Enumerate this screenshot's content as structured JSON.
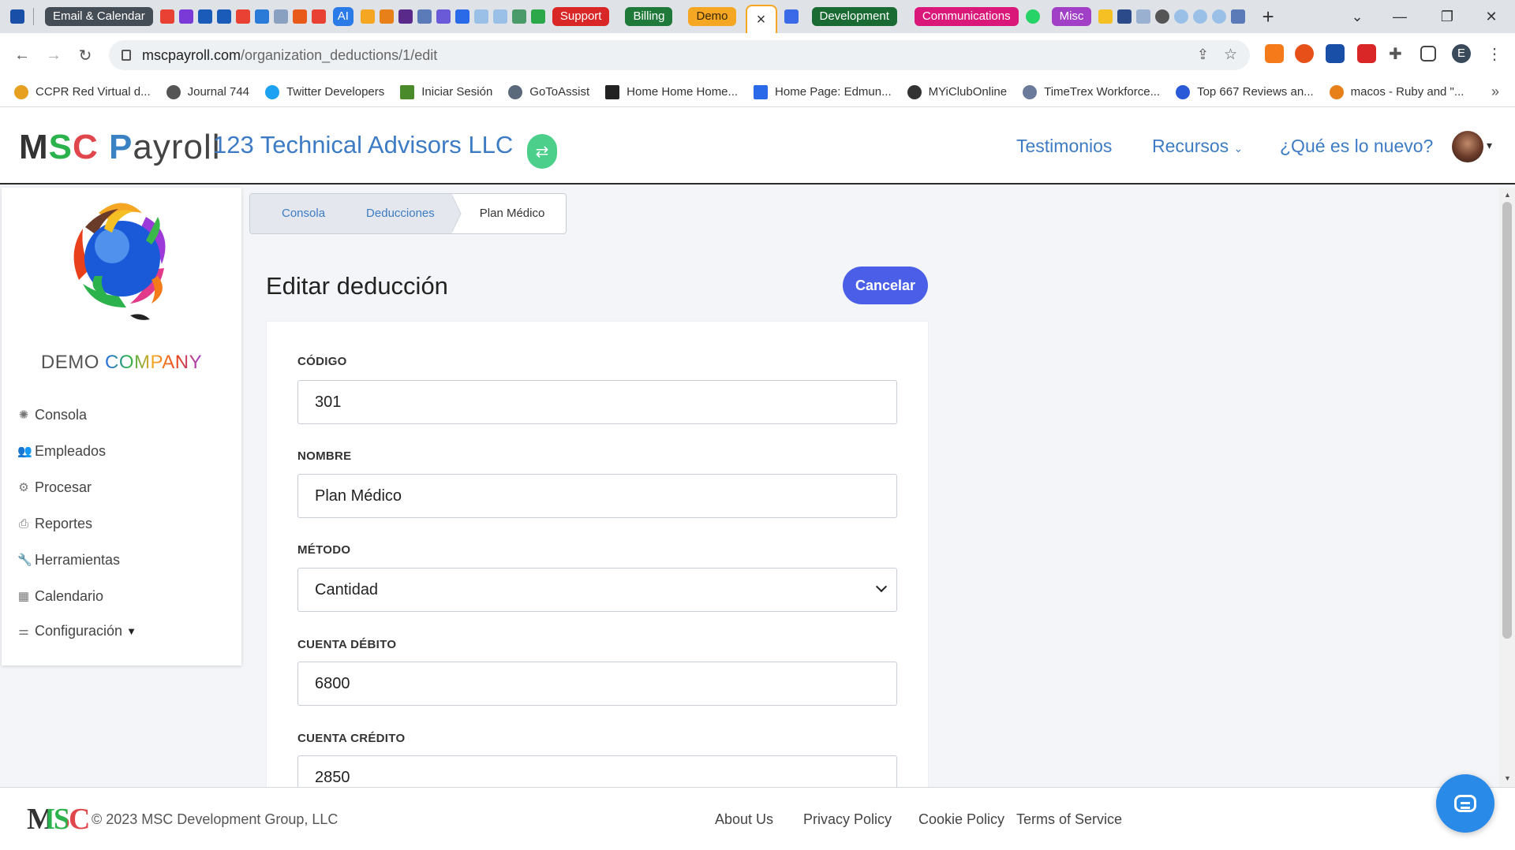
{
  "browser": {
    "tab_groups": [
      {
        "label": "Email & Calendar",
        "color": "gray"
      },
      {
        "label": "AI",
        "color": "blue"
      },
      {
        "label": "Support",
        "color": "red"
      },
      {
        "label": "Billing",
        "color": "green"
      },
      {
        "label": "Demo",
        "color": "orange"
      },
      {
        "label": "Development",
        "color": "dgreen"
      },
      {
        "label": "Communications",
        "color": "pink"
      },
      {
        "label": "Misc",
        "color": "purple"
      }
    ],
    "active_tab_close": "×",
    "new_tab": "+",
    "url_host": "mscpayroll.com",
    "url_path": "/organization_deductions/1/edit",
    "profile_initial": "E",
    "bookmarks": [
      {
        "label": "CCPR Red Virtual d...",
        "icon": "sun-icon",
        "color": "#e8a020"
      },
      {
        "label": "Journal 744",
        "icon": "globe-icon",
        "color": "#555555"
      },
      {
        "label": "Twitter Developers",
        "icon": "twitter-icon",
        "color": "#1da1f2"
      },
      {
        "label": "Iniciar Sesión",
        "icon": "l-icon",
        "color": "#4a8a2a"
      },
      {
        "label": "GoToAssist",
        "icon": "gotoassist-icon",
        "color": "#5a6a7a"
      },
      {
        "label": "Home Home Home...",
        "icon": "x-icon",
        "color": "#222222"
      },
      {
        "label": "Home Page: Edmun...",
        "icon": "f-icon",
        "color": "#2a6ae8"
      },
      {
        "label": "MYiClubOnline",
        "icon": "club-icon",
        "color": "#333333"
      },
      {
        "label": "TimeTrex Workforce...",
        "icon": "timetrex-icon",
        "color": "#6a7a9a"
      },
      {
        "label": "Top 667 Reviews an...",
        "icon": "star-icon",
        "color": "#2a5ad8"
      },
      {
        "label": "macos - Ruby and \"...",
        "icon": "stack-icon",
        "color": "#e8801a"
      }
    ],
    "more_bookmarks": "»"
  },
  "header": {
    "logo_m": "M",
    "logo_s": "S",
    "logo_c": "C",
    "logo_p": "P",
    "logo_rest": "ayroll",
    "org_name": "123 Technical Advisors LLC",
    "nav": {
      "testimonials": "Testimonios",
      "resources": "Recursos",
      "whats_new": "¿Qué es lo nuevo?"
    }
  },
  "sidebar": {
    "company_demo": "DEMO ",
    "company_word": "COMPANY",
    "items": [
      {
        "label": "Consola",
        "icon": "dashboard-icon"
      },
      {
        "label": "Empleados",
        "icon": "users-icon"
      },
      {
        "label": "Procesar",
        "icon": "cogs-icon"
      },
      {
        "label": "Reportes",
        "icon": "printer-icon"
      },
      {
        "label": "Herramientas",
        "icon": "wrench-icon"
      },
      {
        "label": "Calendario",
        "icon": "calendar-icon"
      },
      {
        "label": "Configuración",
        "icon": "sliders-icon"
      }
    ]
  },
  "breadcrumb": [
    "Consola",
    "Deducciones",
    "Plan Médico"
  ],
  "form": {
    "title": "Editar deducción",
    "cancel_label": "Cancelar",
    "fields": [
      {
        "label": "CÓDIGO",
        "value": "301"
      },
      {
        "label": "NOMBRE",
        "value": "Plan Médico"
      },
      {
        "label": "MÉTODO",
        "value": "Cantidad"
      },
      {
        "label": "CUENTA DÉBITO",
        "value": "6800"
      },
      {
        "label": "CUENTA CRÉDITO",
        "value": "2850"
      }
    ]
  },
  "footer": {
    "logo": "MSC",
    "copyright": "© 2023 MSC Development Group, LLC",
    "links": [
      "About Us",
      "Privacy Policy",
      "Cookie Policy",
      "Terms of Service"
    ]
  },
  "colors": {
    "accent_blue": "#3d7cc4",
    "cancel_button": "#4b5ee8",
    "switch_button": "#4ccf8a",
    "chat_button": "#2a8ae8"
  }
}
